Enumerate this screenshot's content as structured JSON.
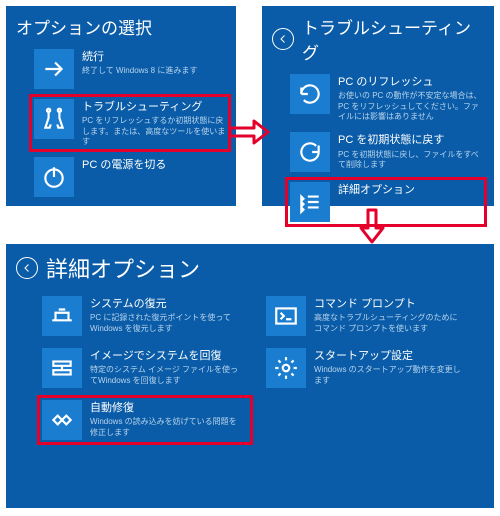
{
  "panel1": {
    "title": "オプションの選択",
    "tiles": [
      {
        "label": "続行",
        "desc": "終了して Windows 8 に進みます"
      },
      {
        "label": "トラブルシューティング",
        "desc": "PC をリフレッシュするか初期状態に戻します。または、高度なツールを使います"
      },
      {
        "label": "PC の電源を切る",
        "desc": ""
      }
    ]
  },
  "panel2": {
    "title": "トラブルシューティング",
    "tiles": [
      {
        "label": "PC のリフレッシュ",
        "desc": "お使いの PC の動作が不安定な場合は、PC をリフレッシュしてください。ファイルには影響はありません"
      },
      {
        "label": "PC を初期状態に戻す",
        "desc": "PC を初期状態に戻し、ファイルをすべて削除します"
      },
      {
        "label": "詳細オプション",
        "desc": ""
      }
    ]
  },
  "panel3": {
    "title": "詳細オプション",
    "tiles": [
      {
        "label": "システムの復元",
        "desc": "PC に記録された復元ポイントを使ってWindows を復元します"
      },
      {
        "label": "コマンド プロンプト",
        "desc": "高度なトラブルシューティングのためにコマンド プロンプトを使います"
      },
      {
        "label": "イメージでシステムを回復",
        "desc": "特定のシステム イメージ ファイルを使ってWindows を回復します"
      },
      {
        "label": "スタートアップ設定",
        "desc": "Windows のスタートアップ動作を変更します"
      },
      {
        "label": "自動修復",
        "desc": "Windows の読み込みを妨げている問題を修正します"
      }
    ]
  }
}
